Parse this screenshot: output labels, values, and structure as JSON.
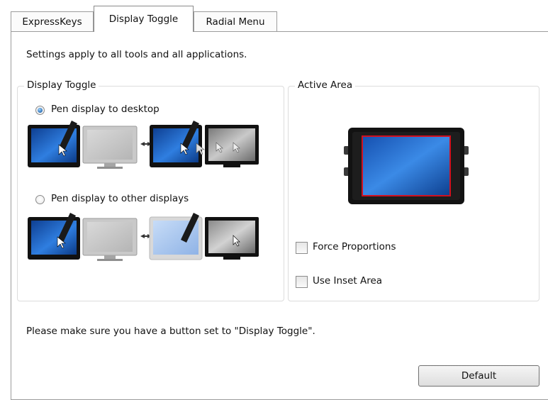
{
  "tabs": [
    {
      "label": "ExpressKeys",
      "active": false
    },
    {
      "label": "Display Toggle",
      "active": true
    },
    {
      "label": "Radial Menu",
      "active": false
    }
  ],
  "info_text": "Settings apply to all tools and all applications.",
  "display_toggle_group": {
    "title": "Display Toggle",
    "options": [
      {
        "label": "Pen display to desktop",
        "selected": true
      },
      {
        "label": "Pen display to other displays",
        "selected": false
      }
    ]
  },
  "active_area_group": {
    "title": "Active Area",
    "force_proportions": {
      "label": "Force Proportions",
      "checked": false
    },
    "use_inset_area": {
      "label": "Use Inset Area",
      "checked": false
    }
  },
  "footer_note": "Please make sure you have a button set to \"Display Toggle\".",
  "default_button": "Default",
  "colors": {
    "accent": "#2c6fb3",
    "screen_blue": "#1f63c4",
    "tablet_red_outline": "#d01020"
  }
}
